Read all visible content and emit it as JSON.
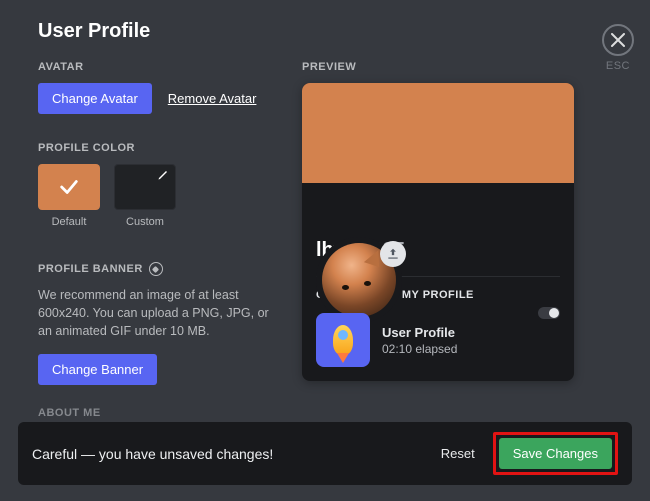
{
  "header": {
    "title": "User Profile",
    "esc": "ESC"
  },
  "avatar": {
    "label": "AVATAR",
    "change": "Change Avatar",
    "remove": "Remove Avatar"
  },
  "profileColor": {
    "label": "PROFILE COLOR",
    "defaultCaption": "Default",
    "customCaption": "Custom",
    "defaultHex": "#d3824e"
  },
  "profileBanner": {
    "label": "PROFILE BANNER",
    "help": "We recommend an image of at least 600x240. You can upload a PNG, JPG, or an animated GIF under 10 MB.",
    "change": "Change Banner"
  },
  "aboutMe": {
    "label": "ABOUT ME"
  },
  "preview": {
    "label": "PREVIEW",
    "username": "lhw",
    "discriminator": "#6335",
    "customizingLabel": "CUSTOMIZING MY PROFILE",
    "activityTitle": "User Profile",
    "activityElapsed": "02:10 elapsed"
  },
  "unsaved": {
    "warning": "Careful — you have unsaved changes!",
    "reset": "Reset",
    "save": "Save Changes"
  }
}
